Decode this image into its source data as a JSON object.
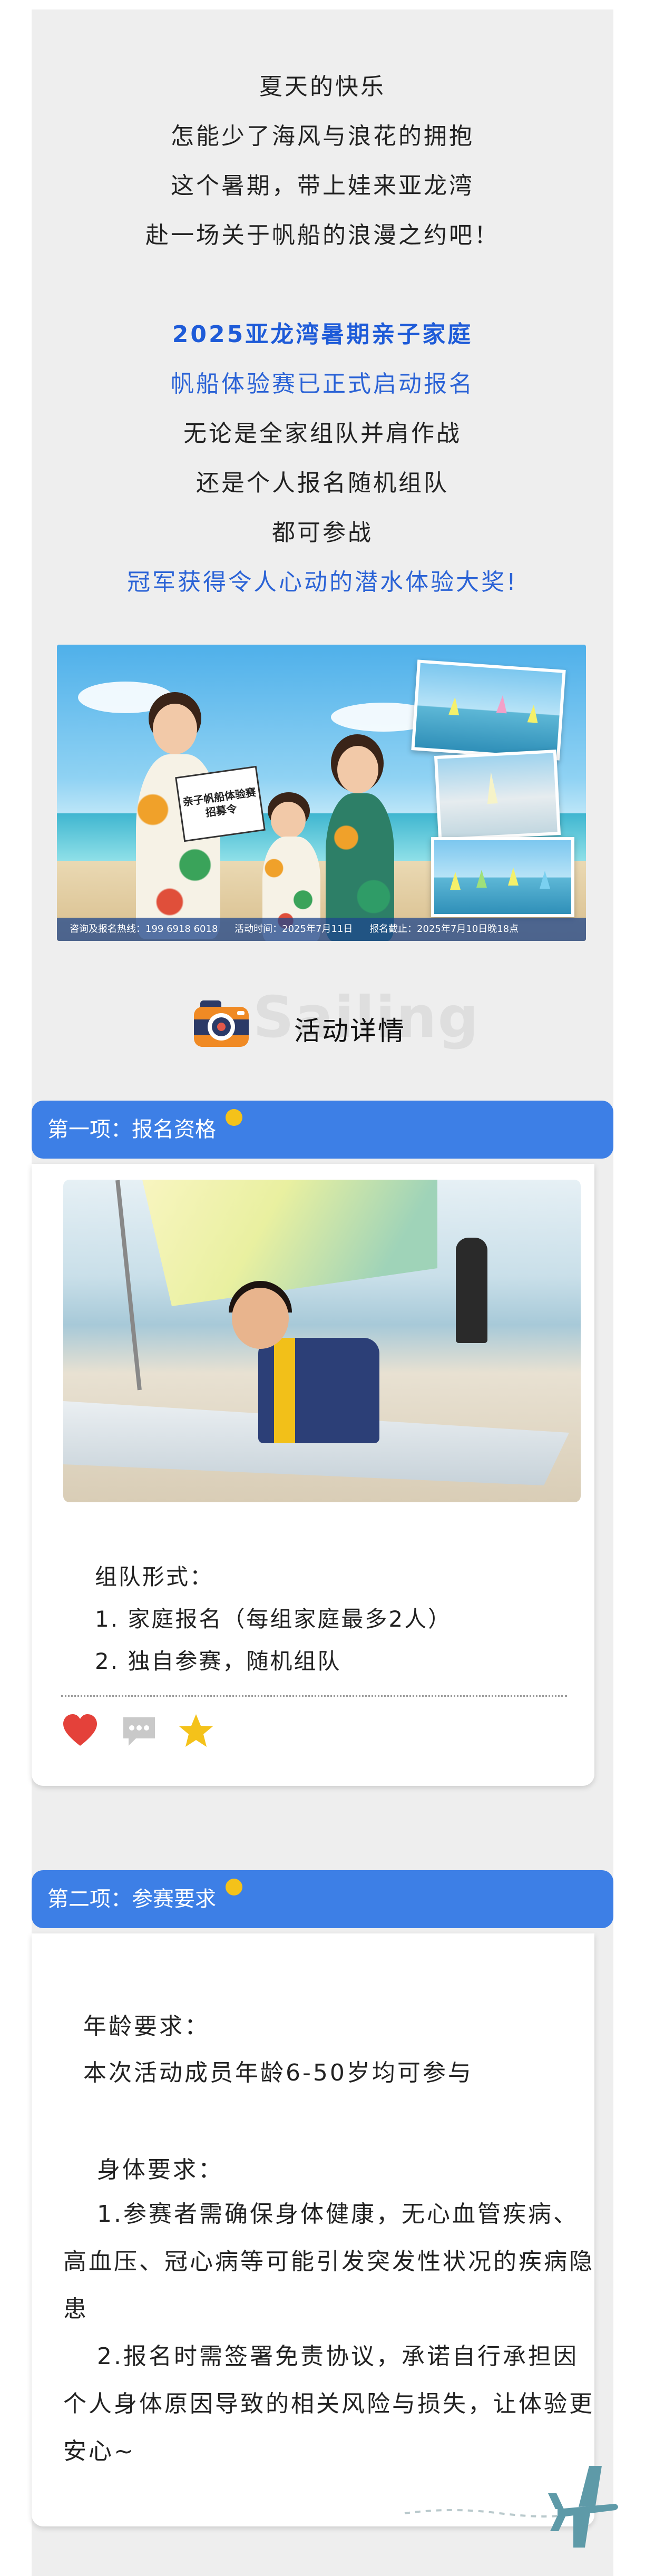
{
  "intro": {
    "lines": [
      "夏天的快乐",
      "怎能少了海风与浪花的拥抱",
      "这个暑期，带上娃来亚龙湾",
      "赴一场关于帆船的浪漫之约吧！"
    ],
    "highlight_lines": [
      "2025亚龙湾暑期亲子家庭",
      "帆船体验赛已正式启动报名"
    ],
    "body_lines": [
      "无论是全家组队并肩作战",
      "还是个人报名随机组队",
      "都可参战"
    ],
    "prize_line": "冠军获得令人心动的潜水体验大奖!"
  },
  "hero": {
    "sign_text": "亲子帆船体验赛招募令",
    "footer": {
      "hotline": "咨询及报名热线：199 6918 6018",
      "event_time": "活动时间：2025年7月11日",
      "deadline": "报名截止：2025年7月10日晚18点"
    }
  },
  "section": {
    "watermark": "Sailing",
    "title": "活动详情",
    "icon": "camera-icon"
  },
  "item1": {
    "tab_label": "第一项：报名资格",
    "heading": "组队形式：",
    "points": [
      "1. 家庭报名（每组家庭最多2人）",
      "2. 独自参赛，随机组队"
    ],
    "icons": [
      "heart-icon",
      "comment-icon",
      "star-icon"
    ]
  },
  "item2": {
    "tab_label": "第二项：参赛要求",
    "age_heading": "年龄要求：",
    "age_text": "本次活动成员年龄6-50岁均可参与",
    "health_heading": "身体要求：",
    "health_point1": "1.参赛者需确保身体健康，无心血管疾病、高血压、冠心病等可能引发突发性状况的疾病隐患",
    "health_point2": "2.报名时需签署免责协议，承诺自行承担因个人身体原因导致的相关风险与损失，让体验更安心~"
  },
  "colors": {
    "accent_blue": "#3d7fe6",
    "text_blue": "#1e5bd8",
    "dot_yellow": "#f4c21a",
    "page_gray": "#eeeeee"
  }
}
